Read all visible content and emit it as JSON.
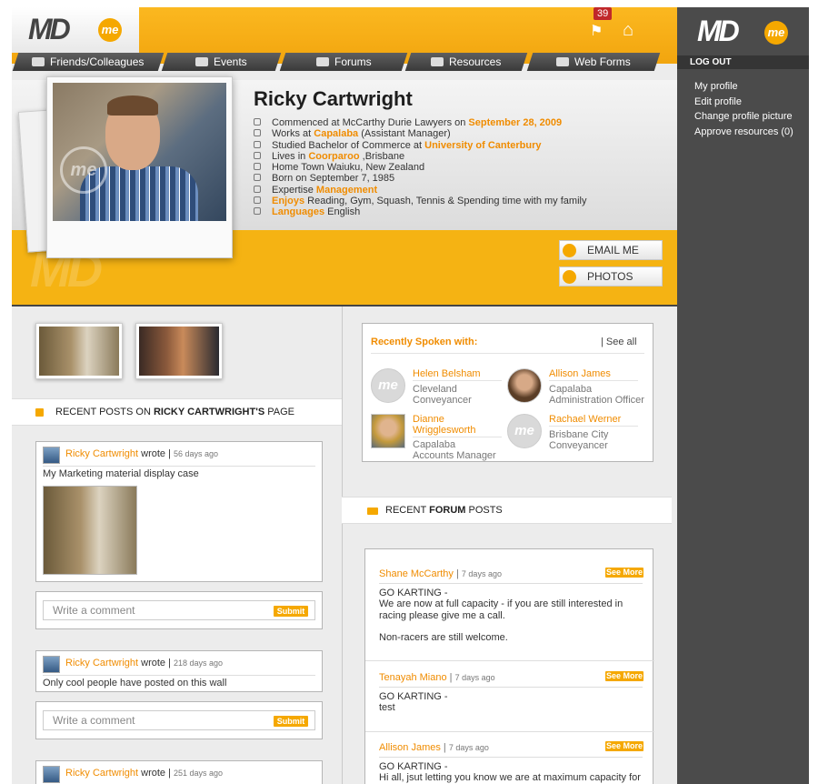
{
  "nav": {
    "tabs": [
      {
        "label": "Friends/Colleagues",
        "icon": "users-icon"
      },
      {
        "label": "Events",
        "icon": "calendar-icon"
      },
      {
        "label": "Forums",
        "icon": "megaphone-icon"
      },
      {
        "label": "Resources",
        "icon": "download-icon"
      },
      {
        "label": "Web Forms",
        "icon": "form-icon"
      }
    ],
    "notification_count": "39",
    "logo_text": "MD",
    "logo_me": "me"
  },
  "profile": {
    "name": "Ricky Cartwright",
    "details": [
      {
        "icon": "clock-icon",
        "pre": "Commenced at McCarthy Durie Lawyers on ",
        "hl": "September 28, 2009",
        "post": ""
      },
      {
        "icon": "briefcase-icon",
        "pre": "Works at ",
        "hl": "Capalaba",
        "post": " (Assistant Manager)"
      },
      {
        "icon": "graduation-icon",
        "pre": "Studied Bachelor of Commerce at ",
        "hl": "University of Canterbury",
        "post": ""
      },
      {
        "icon": "building-icon",
        "pre": "Lives in ",
        "hl": "Coorparoo",
        "post": " ,Brisbane"
      },
      {
        "icon": "house-icon",
        "pre": "Home Town Waiuku, New Zealand",
        "hl": "",
        "post": ""
      },
      {
        "icon": "calendar-icon",
        "pre": "Born on September 7, 1985",
        "hl": "",
        "post": ""
      },
      {
        "icon": "star-icon",
        "pre": "Expertise ",
        "hl": "Management",
        "post": ""
      },
      {
        "icon": "check-icon",
        "pre": "",
        "hl": "Enjoys",
        "post": " Reading, Gym, Squash, Tennis & Spending time with my family"
      },
      {
        "icon": "globe-icon",
        "pre": "",
        "hl": "Languages",
        "post": " English"
      }
    ],
    "email_button": "EMAIL ME",
    "photos_button": "PHOTOS"
  },
  "wall": {
    "header_pre": "RECENT POSTS ON ",
    "header_bold": "RICKY CARTWRIGHT'S",
    "header_post": " PAGE",
    "posts": [
      {
        "author": "Ricky Cartwright",
        "wrote": " wrote | ",
        "time": "56 days ago",
        "text": "My Marketing material display case"
      },
      {
        "author": "Ricky Cartwright",
        "wrote": " wrote | ",
        "time": "218 days ago",
        "text": "Only cool people have posted on this wall"
      },
      {
        "author": "Ricky Cartwright",
        "wrote": " wrote | ",
        "time": "251 days ago",
        "text": ""
      }
    ],
    "comment_placeholder": "Write a comment",
    "submit_label": "Submit"
  },
  "recent": {
    "title": "Recently Spoken with:",
    "see_all": "| See all",
    "people": [
      {
        "name": "Helen Belsham",
        "line1": "Cleveland",
        "line2": "Conveyancer",
        "avatar": "md"
      },
      {
        "name": "Allison James",
        "line1": "Capalaba",
        "line2": "Administration Officer",
        "avatar": "photo"
      },
      {
        "name": "Dianne Wrigglesworth",
        "line1": "Capalaba",
        "line2": "Accounts Manager",
        "avatar": "photo"
      },
      {
        "name": "Rachael Werner",
        "line1": "Brisbane City",
        "line2": "Conveyancer",
        "avatar": "md"
      }
    ]
  },
  "forum": {
    "header_pre": "RECENT ",
    "header_bold": "FORUM",
    "header_post": " POSTS",
    "see_more": "See More",
    "posts": [
      {
        "author": "Shane McCarthy",
        "time": "7 days ago",
        "body": "GO KARTING -\nWe are now at full capacity - if you are still interested in racing please give me a call.\n\nNon-racers are still welcome."
      },
      {
        "author": "Tenayah Miano",
        "time": "7 days ago",
        "body": "GO KARTING -\ntest"
      },
      {
        "author": "Allison James",
        "time": "7 days ago",
        "body": "GO KARTING -\nHi all, jsut letting you know we are at maximum capacity for"
      }
    ]
  },
  "sidebar": {
    "logout": "LOG OUT",
    "links": [
      "My profile",
      "Edit profile",
      "Change profile picture",
      "Approve resources (0)"
    ]
  },
  "colors": {
    "accent": "#f5a800",
    "link": "#f08c00",
    "sidebar": "#4b4b4b"
  }
}
